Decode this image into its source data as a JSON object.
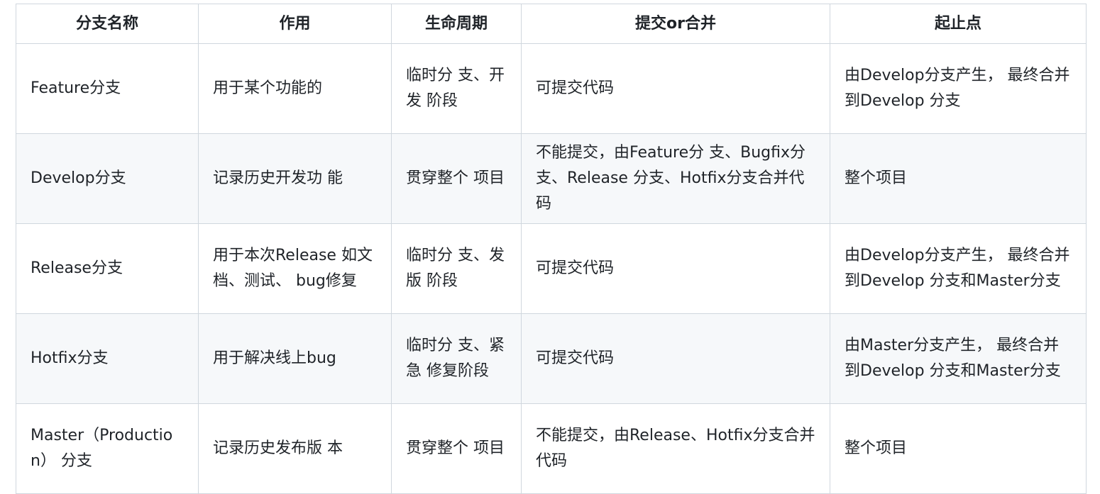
{
  "table": {
    "headers": [
      "分支名称",
      "作用",
      "生命周期",
      "提交or合并",
      "起止点"
    ],
    "rows": [
      [
        "Feature分支",
        "用于某个功能的",
        "临时分 支、开发 阶段",
        "可提交代码",
        "由Develop分支产生， 最终合并到Develop 分支"
      ],
      [
        "Develop分支",
        "记录历史开发功 能",
        "贯穿整个 项目",
        "不能提交，由Feature分 支、Bugfix分支、Release 分支、Hotfix分支合并代码",
        "整个项目"
      ],
      [
        "Release分支",
        "用于本次Release 如文档、测试、 bug修复",
        "临时分 支、发版 阶段",
        "可提交代码",
        "由Develop分支产生， 最终合并到Develop 分支和Master分支"
      ],
      [
        "Hotfix分支",
        "用于解决线上bug",
        "临时分 支、紧急 修复阶段",
        "可提交代码",
        "由Master分支产生， 最终合并到Develop 分支和Master分支"
      ],
      [
        "Master（Production） 分支",
        "记录历史发布版 本",
        "贯穿整个 项目",
        "不能提交，由Release、Hotfix分支合并代码",
        "整个项目"
      ]
    ]
  }
}
